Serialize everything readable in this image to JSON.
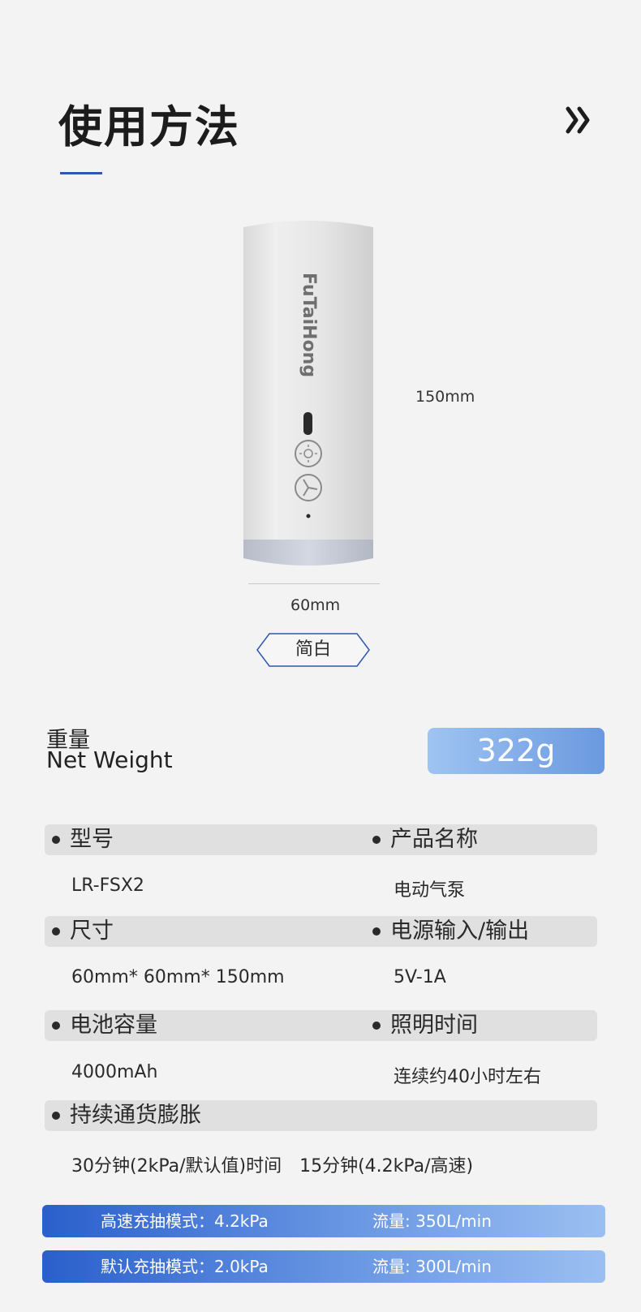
{
  "header": {
    "title": "使用方法"
  },
  "product": {
    "brand": "FuTaiHong",
    "height_label": "150mm",
    "width_label": "60mm",
    "color_option": "简白"
  },
  "weight": {
    "label_cn": "重量",
    "label_en": "Net Weight",
    "value": "322g"
  },
  "specs": [
    {
      "head": "型号",
      "value": "LR-FSX2"
    },
    {
      "head": "产品名称",
      "value": "电动气泵"
    },
    {
      "head": "尺寸",
      "value": "60mm* 60mm* 150mm"
    },
    {
      "head": "电源输入/输出",
      "value": "5V-1A"
    },
    {
      "head": "电池容量",
      "value": "4000mAh"
    },
    {
      "head": "照明时间",
      "value": "连续约40小时左右"
    },
    {
      "head": "持续通货膨胀",
      "value": "30分钟(2kPa/默认值)时间　15分钟(4.2kPa/高速)"
    }
  ],
  "modes": [
    {
      "mode": "高速充抽模式：4.2kPa",
      "flow": "流量: 350L/min"
    },
    {
      "mode": "默认充抽模式：2.0kPa",
      "flow": "流量: 300L/min"
    }
  ],
  "colors": {
    "accent": "#2d57b3",
    "bar_gray": "#e0e0e0",
    "weight_blue": "#6b99e0"
  },
  "icons": [
    "double-chevron-right-icon",
    "light-button-icon",
    "fan-button-icon"
  ]
}
